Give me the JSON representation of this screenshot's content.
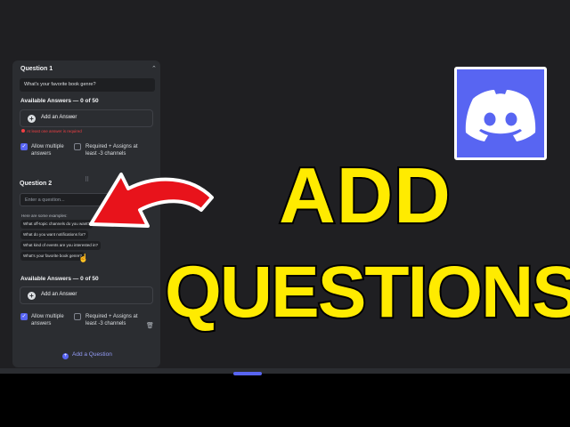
{
  "form": {
    "question1": {
      "label": "Question 1",
      "value": "What's your favorite book genre?",
      "answers_label": "Available Answers — 0 of 50",
      "add_answer": "Add an Answer",
      "error": "At least one answer is required",
      "allow_multiple": "Allow multiple answers",
      "required": "Required + Assigns at least -3 channels"
    },
    "question2": {
      "label": "Question 2",
      "placeholder": "Enter a question...",
      "examples_head": "Here are some examples:",
      "examples": [
        "What off-topic channels do you want?",
        "What do you want notifications for?",
        "What kind of events are you interested in?",
        "What's your favorite book genre?"
      ],
      "answers_label": "Available Answers — 0 of 50",
      "add_answer": "Add an Answer",
      "allow_multiple": "Allow multiple answers",
      "required": "Required + Assigns at least -3 channels"
    },
    "add_question": "Add a Question"
  },
  "overlay": {
    "line1": "ADD",
    "line2": "QUESTIONS",
    "text_color": "#ffeb00",
    "arrow_color": "#e8131b",
    "logo_bg": "#5865f2"
  },
  "icons": {
    "logo": "discord-logo-icon",
    "arrow": "curved-arrow-icon",
    "plus": "plus-circle-icon",
    "trash": "trash-icon",
    "drag": "drag-handle-icon",
    "collapse": "chevron-up-icon",
    "cursor": "hand-cursor-icon"
  }
}
